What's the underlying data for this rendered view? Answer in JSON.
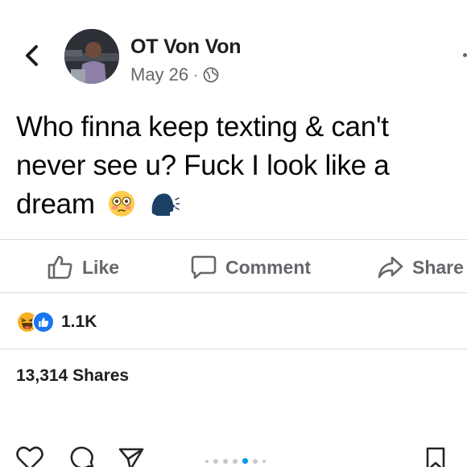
{
  "post": {
    "author": "OT Von Von",
    "date": "May 26",
    "separator": "·",
    "privacy_icon": "globe-icon",
    "text": "Who finna keep texting & can't never see u? Fuck I look like a dream",
    "emojis": [
      "flushed-face-emoji",
      "speaking-head-emoji"
    ]
  },
  "actions": {
    "like_label": "Like",
    "comment_label": "Comment",
    "share_label": "Share"
  },
  "reactions": {
    "icons": [
      "haha-reaction-icon",
      "like-reaction-icon"
    ],
    "count": "1.1K"
  },
  "shares_label": "13,314 Shares",
  "bottom_bar": {
    "icons": [
      "heart-icon",
      "comment-icon",
      "send-icon",
      "bookmark-icon"
    ],
    "carousel_dots": 7,
    "active_dot_index": 4
  },
  "colors": {
    "text_primary": "#1c1e21",
    "text_secondary": "#65676b",
    "like_blue": "#1877f2",
    "haha_yellow": "#f7b125",
    "active_dot": "#0095f6"
  }
}
